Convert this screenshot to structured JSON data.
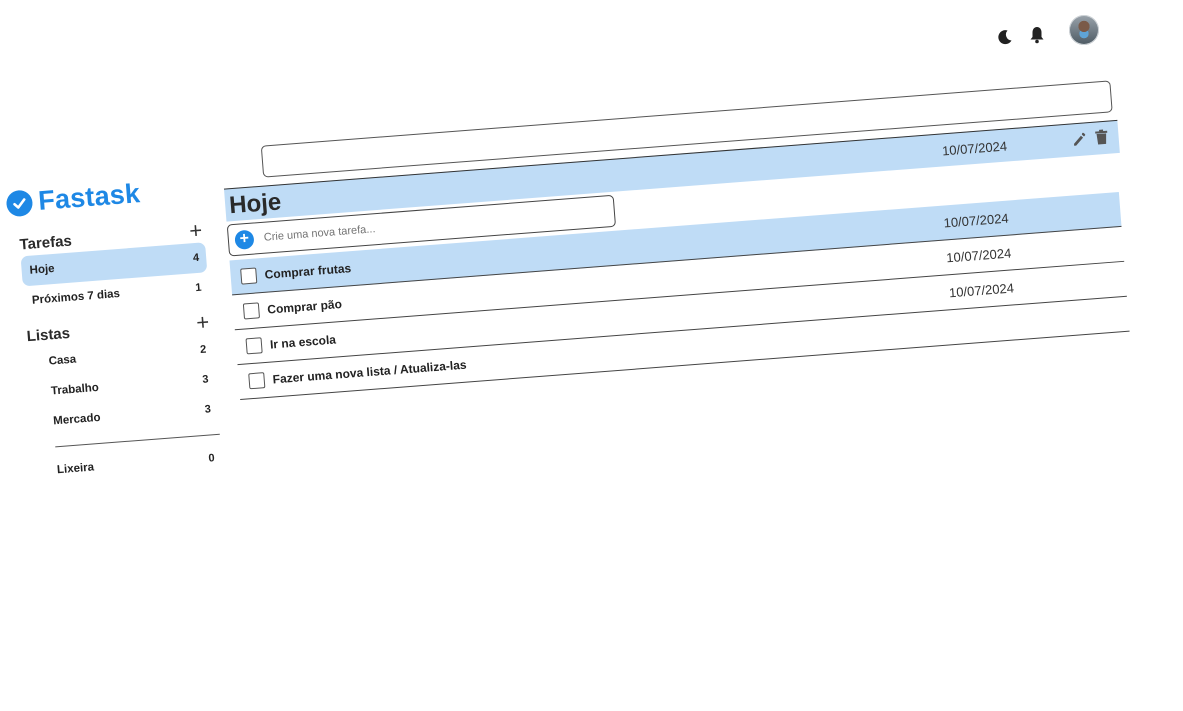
{
  "header": {
    "icons": [
      "moon-icon",
      "bell-icon"
    ],
    "avatar": "user-avatar"
  },
  "brand": {
    "name": "Fastask",
    "color": "#1e88e5"
  },
  "sidebar": {
    "tasks_section": {
      "title": "Tarefas",
      "items": [
        {
          "label": "Hoje",
          "count": "4"
        },
        {
          "label": "Próximos 7 dias",
          "count": "1"
        }
      ]
    },
    "lists_section": {
      "title": "Listas",
      "items": [
        {
          "label": "Casa",
          "count": "2"
        },
        {
          "label": "Trabalho",
          "count": "3"
        },
        {
          "label": "Mercado",
          "count": "3"
        }
      ]
    },
    "trash": {
      "label": "Lixeira",
      "count": "0"
    }
  },
  "main": {
    "title": "Hoje",
    "new_task_placeholder": "Crie uma nova tarefa...",
    "selected_date": "10/07/2024",
    "tasks": [
      {
        "title": "Comprar frutas",
        "date": "10/07/2024"
      },
      {
        "title": "Comprar pão",
        "date": "10/07/2024"
      },
      {
        "title": "Ir na escola",
        "date": "10/07/2024"
      },
      {
        "title": "Fazer uma nova lista / Atualiza-las",
        "date": ""
      }
    ]
  },
  "colors": {
    "accent": "#1e88e5",
    "selected_row": "#bfdcf6"
  }
}
